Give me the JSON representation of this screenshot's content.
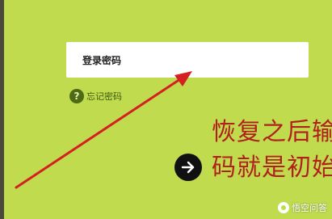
{
  "password_field": {
    "label": "登录密码"
  },
  "forgot_password": {
    "icon": "question-mark-icon",
    "icon_glyph": "?",
    "label": "忘记密码"
  },
  "annotation": {
    "line1": "恢复之后输",
    "line2": "码就是初始",
    "color": "#b0201c",
    "arrow_color": "#d42020"
  },
  "next_button": {
    "icon": "arrow-right-icon"
  },
  "watermark": {
    "text": "悟空问答"
  },
  "colors": {
    "background": "#c0db4e",
    "field_background": "#ffffff"
  }
}
